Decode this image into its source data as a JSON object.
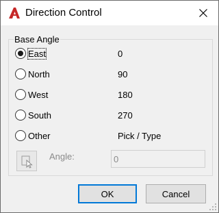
{
  "window": {
    "title": "Direction Control"
  },
  "group": {
    "label": "Base Angle"
  },
  "options": [
    {
      "label": "East",
      "value": "0",
      "selected": true
    },
    {
      "label": "North",
      "value": "90",
      "selected": false
    },
    {
      "label": "West",
      "value": "180",
      "selected": false
    },
    {
      "label": "South",
      "value": "270",
      "selected": false
    },
    {
      "label": "Other",
      "value": "Pick / Type",
      "selected": false
    }
  ],
  "angle": {
    "label": "Angle:",
    "value": "0"
  },
  "buttons": {
    "ok": "OK",
    "cancel": "Cancel"
  },
  "colors": {
    "app_icon": "#c62828",
    "ok_focus": "#0078d7"
  },
  "icons": {
    "app": "autocad-icon",
    "close": "close-icon",
    "pick": "pick-point-icon"
  }
}
